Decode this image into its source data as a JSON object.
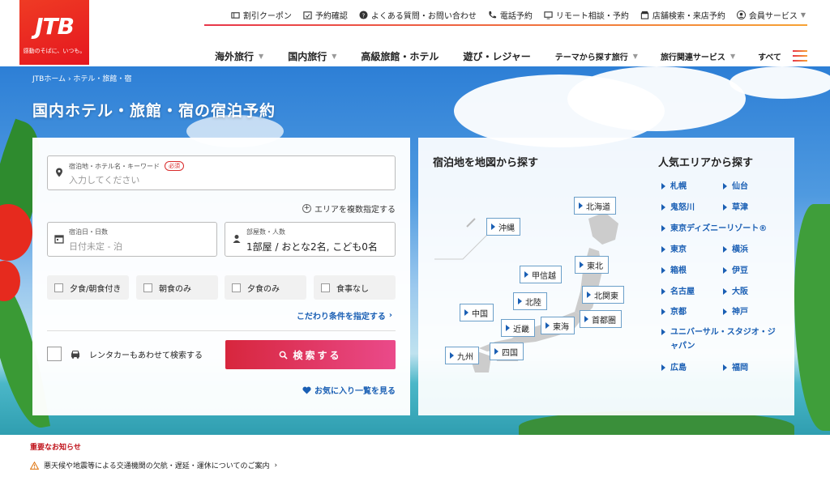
{
  "logo": {
    "mark": "JTB",
    "tagline": "感動のそばに、いつも。"
  },
  "utility_nav": [
    {
      "label": "割引クーポン",
      "icon": "coupon-icon"
    },
    {
      "label": "予約確認",
      "icon": "calendar-check-icon"
    },
    {
      "label": "よくある質問・お問い合わせ",
      "icon": "question-icon"
    },
    {
      "label": "電話予約",
      "icon": "phone-icon"
    },
    {
      "label": "リモート相談・予約",
      "icon": "monitor-icon"
    },
    {
      "label": "店舗検索・来店予約",
      "icon": "store-icon"
    },
    {
      "label": "会員サービス",
      "icon": "user-icon"
    }
  ],
  "main_nav": [
    {
      "label": "海外旅行"
    },
    {
      "label": "国内旅行"
    },
    {
      "label": "高級旅館・ホテル"
    },
    {
      "label": "遊び・レジャー"
    },
    {
      "label": "テーマから探す旅行"
    },
    {
      "label": "旅行関連サービス"
    },
    {
      "label": "すべて"
    }
  ],
  "breadcrumb": {
    "home": "JTBホーム",
    "current": "ホテル・旅館・宿"
  },
  "hero_title": "国内ホテル・旅館・宿の宿泊予約",
  "search": {
    "destination_label": "宿泊地・ホテル名・キーワード",
    "required_badge": "必須",
    "destination_placeholder": "入力してください",
    "multi_area": "エリアを複数指定する",
    "date_label": "宿泊日・日数",
    "date_value": "日付未定 - 泊",
    "room_label": "部屋数・人数",
    "room_value": "1部屋 / おとな2名, こども0名",
    "meal_options": [
      "夕食/朝食付き",
      "朝食のみ",
      "夕食のみ",
      "食事なし"
    ],
    "detail_link": "こだわり条件を指定する",
    "rental_car": "レンタカーもあわせて検索する",
    "search_button": "検索する",
    "favorites_link": "お気に入り一覧を見る"
  },
  "map": {
    "heading": "宿泊地を地図から探す",
    "regions": [
      "北海道",
      "沖縄",
      "東北",
      "甲信越",
      "北関東",
      "北陸",
      "中国",
      "首都圏",
      "近畿",
      "東海",
      "四国",
      "九州"
    ]
  },
  "popular": {
    "heading": "人気エリアから探す",
    "areas": [
      "札幌",
      "仙台",
      "鬼怒川",
      "草津",
      "東京ディズニーリゾート®",
      "東京",
      "横浜",
      "箱根",
      "伊豆",
      "名古屋",
      "大阪",
      "京都",
      "神戸",
      "ユニバーサル・スタジオ・ジャパン",
      "広島",
      "福岡"
    ]
  },
  "notice": {
    "heading": "重要なお知らせ",
    "item": "悪天候や地震等による交通機関の欠航・遅延・運休についてのご案内"
  }
}
